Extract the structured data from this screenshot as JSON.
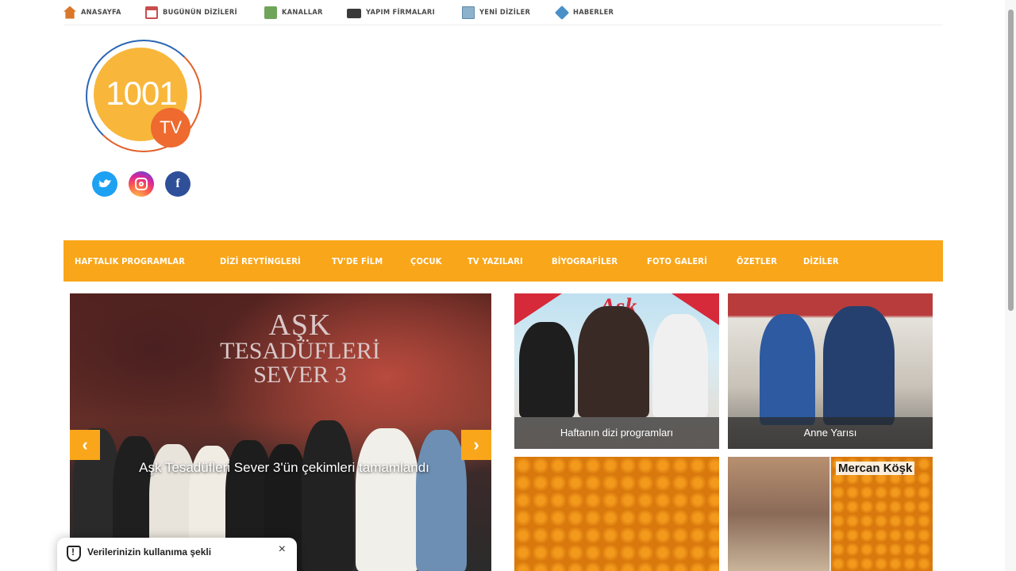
{
  "top_nav": [
    {
      "label": "ANASAYFA",
      "icon": "home-icon"
    },
    {
      "label": "BUGÜNÜN DİZİLERİ",
      "icon": "calendar-icon"
    },
    {
      "label": "KANALLAR",
      "icon": "tv-icon"
    },
    {
      "label": "YAPIM FİRMALARI",
      "icon": "camera-icon"
    },
    {
      "label": "YENİ DİZİLER",
      "icon": "document-icon"
    },
    {
      "label": "HABERLER",
      "icon": "news-icon"
    }
  ],
  "logo": {
    "number": "1001",
    "suffix": "TV"
  },
  "social": [
    "twitter-icon",
    "instagram-icon",
    "facebook-icon"
  ],
  "main_nav": [
    "HAFTALIK PROGRAMLAR",
    "DİZİ REYTİNGLERİ",
    "TV'DE FİLM",
    "ÇOCUK",
    "TV YAZILARI",
    "BİYOGRAFİLER",
    "FOTO GALERİ",
    "ÖZETLER",
    "DİZİLER"
  ],
  "slider": {
    "poster_title": [
      "AŞK",
      "TESADÜFLERİ",
      "SEVER 3"
    ],
    "caption": "Aşk Tesadüfleri Sever 3'ün çekimleri tamamlandı",
    "prev": "‹",
    "next": "›"
  },
  "tiles": {
    "t1": {
      "caption": "Haftanın dizi programları",
      "art_title": "Aşk"
    },
    "t2": {
      "caption": "Anne Yarısı"
    },
    "t4": {
      "label": "Mercan Köşk"
    }
  },
  "cookie": {
    "title": "Verilerinizin kullanıma şekli",
    "close": "×"
  },
  "colors": {
    "accent": "#f9a61a",
    "logo_yellow": "#f8b73b",
    "logo_orange": "#ee6a2f"
  }
}
